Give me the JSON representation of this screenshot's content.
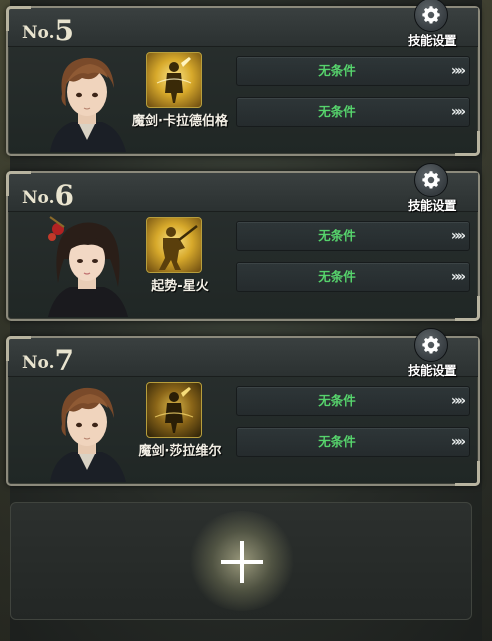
{
  "settings_label": "技能设置",
  "condition_label": "无条件",
  "arrow_glyph": "»»",
  "number_prefix": "No.",
  "slots": [
    {
      "number": "5",
      "skill_name": "魔剑·卡拉德伯格",
      "skill_icon": "sword-figure-icon",
      "conditions": [
        "无条件",
        "无条件"
      ]
    },
    {
      "number": "6",
      "skill_name": "起势-星火",
      "skill_icon": "warrior-stance-icon",
      "conditions": [
        "无条件",
        "无条件"
      ]
    },
    {
      "number": "7",
      "skill_name": "魔剑·莎拉维尔",
      "skill_icon": "sword-figure-icon",
      "conditions": [
        "无条件",
        "无条件"
      ]
    }
  ],
  "add_slot_icon": "plus-icon",
  "colors": {
    "condition_text": "#56d36c",
    "frame": "#8c8a7c",
    "gold": "#d7a92b"
  }
}
